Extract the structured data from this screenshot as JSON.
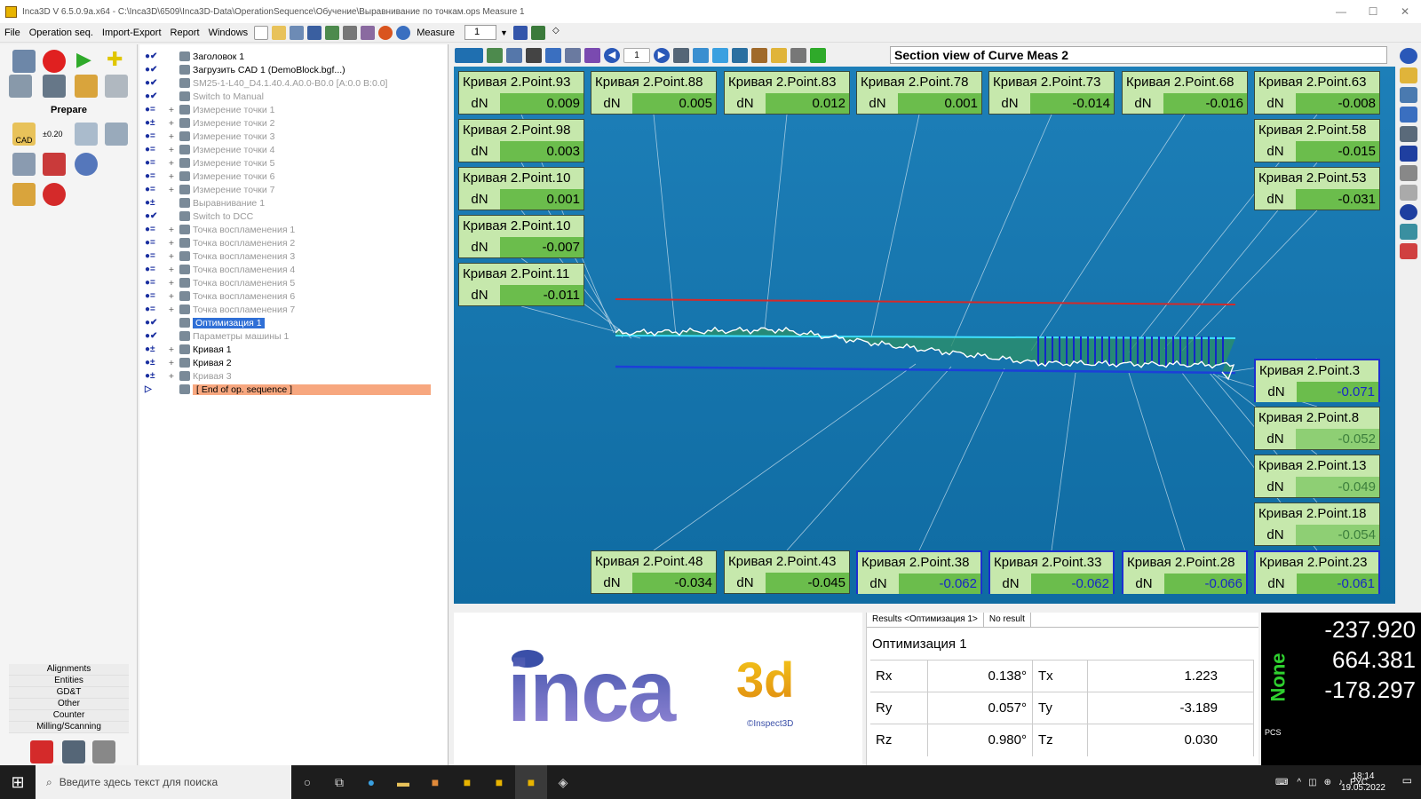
{
  "window": {
    "title": "Inca3D V 6.5.0.9a.x64 - C:\\Inca3D\\6509\\Inca3D-Data\\OperationSequence\\Обучение\\Выравнивание по точкам.ops   Measure 1"
  },
  "menu": {
    "items": [
      "File",
      "Operation seq.",
      "Import-Export",
      "Report",
      "Windows"
    ],
    "measure_label": "Measure",
    "measure_value": "1"
  },
  "left_panel": {
    "prepare_label": "Prepare",
    "cad_label": "CAD",
    "tolerance_label": "±0.20",
    "categories": [
      "Alignments",
      "Entities",
      "GD&T",
      "Other",
      "Counter",
      "Milling/Scanning"
    ]
  },
  "tree": {
    "rows": [
      {
        "status": "●✔",
        "label": "Заголовок 1",
        "style": "normal"
      },
      {
        "status": "●✔",
        "label": "Загрузить CAD 1  (DemoBlock.bgf...)",
        "style": "normal"
      },
      {
        "status": "●✔",
        "label": "SM25-1-L40_D4.1.40.4.A0.0-B0.0 [A:0.0 B:0.0]",
        "style": "dim"
      },
      {
        "status": "●✔",
        "label": "Switch to Manual",
        "style": "dim"
      },
      {
        "status": "●=",
        "label": "Измерение точки 1",
        "style": "dim"
      },
      {
        "status": "●±",
        "label": "Измерение точки 2",
        "style": "dim"
      },
      {
        "status": "●=",
        "label": "Измерение точки 3",
        "style": "dim"
      },
      {
        "status": "●=",
        "label": "Измерение точки 4",
        "style": "dim"
      },
      {
        "status": "●=",
        "label": "Измерение точки 5",
        "style": "dim"
      },
      {
        "status": "●=",
        "label": "Измерение точки 6",
        "style": "dim"
      },
      {
        "status": "●=",
        "label": "Измерение точки 7",
        "style": "dim"
      },
      {
        "status": "●±",
        "label": "Выравнивание 1",
        "style": "dim"
      },
      {
        "status": "●✔",
        "label": "Switch to DCC",
        "style": "dim"
      },
      {
        "status": "●=",
        "label": "Точка воспламенения 1",
        "style": "dim"
      },
      {
        "status": "●=",
        "label": "Точка воспламенения 2",
        "style": "dim"
      },
      {
        "status": "●=",
        "label": "Точка воспламенения 3",
        "style": "dim"
      },
      {
        "status": "●=",
        "label": "Точка воспламенения 4",
        "style": "dim"
      },
      {
        "status": "●=",
        "label": "Точка воспламенения 5",
        "style": "dim"
      },
      {
        "status": "●=",
        "label": "Точка воспламенения 6",
        "style": "dim"
      },
      {
        "status": "●=",
        "label": "Точка воспламенения 7",
        "style": "dim"
      },
      {
        "status": "●✔",
        "label": "Оптимизация 1",
        "style": "selected"
      },
      {
        "status": "●✔",
        "label": "Параметры машины 1",
        "style": "dim"
      },
      {
        "status": "●±",
        "label": "Кривая 1",
        "style": "normal"
      },
      {
        "status": "●±",
        "label": "Кривая 2",
        "style": "normal"
      },
      {
        "status": "●±",
        "label": "Кривая 3",
        "style": "dim"
      },
      {
        "status": "▷",
        "label": "[ End of op. sequence ]",
        "style": "end"
      }
    ]
  },
  "view": {
    "title": "Section view of Curve Meas 2",
    "page_value": "1"
  },
  "cards": [
    {
      "title": "Кривая 2.Point.93",
      "label": "dN",
      "value": "0.009",
      "style": "green"
    },
    {
      "title": "Кривая 2.Point.88",
      "label": "dN",
      "value": "0.005",
      "style": "green"
    },
    {
      "title": "Кривая 2.Point.83",
      "label": "dN",
      "value": "0.012",
      "style": "green"
    },
    {
      "title": "Кривая 2.Point.78",
      "label": "dN",
      "value": "0.001",
      "style": "green"
    },
    {
      "title": "Кривая 2.Point.73",
      "label": "dN",
      "value": "-0.014",
      "style": "green"
    },
    {
      "title": "Кривая 2.Point.68",
      "label": "dN",
      "value": "-0.016",
      "style": "green"
    },
    {
      "title": "Кривая 2.Point.63",
      "label": "dN",
      "value": "-0.008",
      "style": "green"
    },
    {
      "title": "Кривая 2.Point.98",
      "label": "dN",
      "value": "0.003",
      "style": "green"
    },
    {
      "title": "Кривая 2.Point.10",
      "label": "dN",
      "value": "0.001",
      "style": "green"
    },
    {
      "title": "Кривая 2.Point.10",
      "label": "dN",
      "value": "-0.007",
      "style": "green"
    },
    {
      "title": "Кривая 2.Point.11",
      "label": "dN",
      "value": "-0.011",
      "style": "green"
    },
    {
      "title": "Кривая 2.Point.58",
      "label": "dN",
      "value": "-0.015",
      "style": "green"
    },
    {
      "title": "Кривая 2.Point.53",
      "label": "dN",
      "value": "-0.031",
      "style": "green"
    },
    {
      "title": "Кривая 2.Point.3",
      "label": "dN",
      "value": "-0.071",
      "style": "blue"
    },
    {
      "title": "Кривая 2.Point.8",
      "label": "dN",
      "value": "-0.052",
      "style": "gray"
    },
    {
      "title": "Кривая 2.Point.13",
      "label": "dN",
      "value": "-0.049",
      "style": "gray"
    },
    {
      "title": "Кривая 2.Point.18",
      "label": "dN",
      "value": "-0.054",
      "style": "gray"
    },
    {
      "title": "Кривая 2.Point.48",
      "label": "dN",
      "value": "-0.034",
      "style": "green"
    },
    {
      "title": "Кривая 2.Point.43",
      "label": "dN",
      "value": "-0.045",
      "style": "green"
    },
    {
      "title": "Кривая 2.Point.38",
      "label": "dN",
      "value": "-0.062",
      "style": "blue"
    },
    {
      "title": "Кривая 2.Point.33",
      "label": "dN",
      "value": "-0.062",
      "style": "blue"
    },
    {
      "title": "Кривая 2.Point.28",
      "label": "dN",
      "value": "-0.066",
      "style": "blue"
    },
    {
      "title": "Кривая 2.Point.23",
      "label": "dN",
      "value": "-0.061",
      "style": "blue"
    }
  ],
  "logo": {
    "main": "inca",
    "accent": "3d",
    "credit": "©Inspect3D"
  },
  "results": {
    "tab_results": "Results  <Оптимизация 1>",
    "tab_noresult": "No result",
    "title": "Оптимизация 1",
    "rows": [
      {
        "r_label": "Rx",
        "r_value": "0.138°",
        "t_label": "Tx",
        "t_value": "1.223"
      },
      {
        "r_label": "Ry",
        "r_value": "0.057°",
        "t_label": "Ty",
        "t_value": "-3.189"
      },
      {
        "r_label": "Rz",
        "r_value": "0.980°",
        "t_label": "Tz",
        "t_value": "0.030"
      }
    ]
  },
  "coords": {
    "x": "-237.920",
    "y": "664.381",
    "z": "-178.297",
    "mode": "None",
    "pcs": "PCS"
  },
  "taskbar": {
    "search_placeholder": "Введите здесь текст для поиска",
    "lang": "РУС",
    "time": "18:14",
    "date": "19.05.2022"
  },
  "colors": {
    "viewport": "#1378b0",
    "card_bg": "#c6e8ac",
    "card_value": "#6bbd4c",
    "nominal": "#1c3fd8",
    "tolerance": "#d42a2a",
    "selected": "#2f6fd6"
  }
}
